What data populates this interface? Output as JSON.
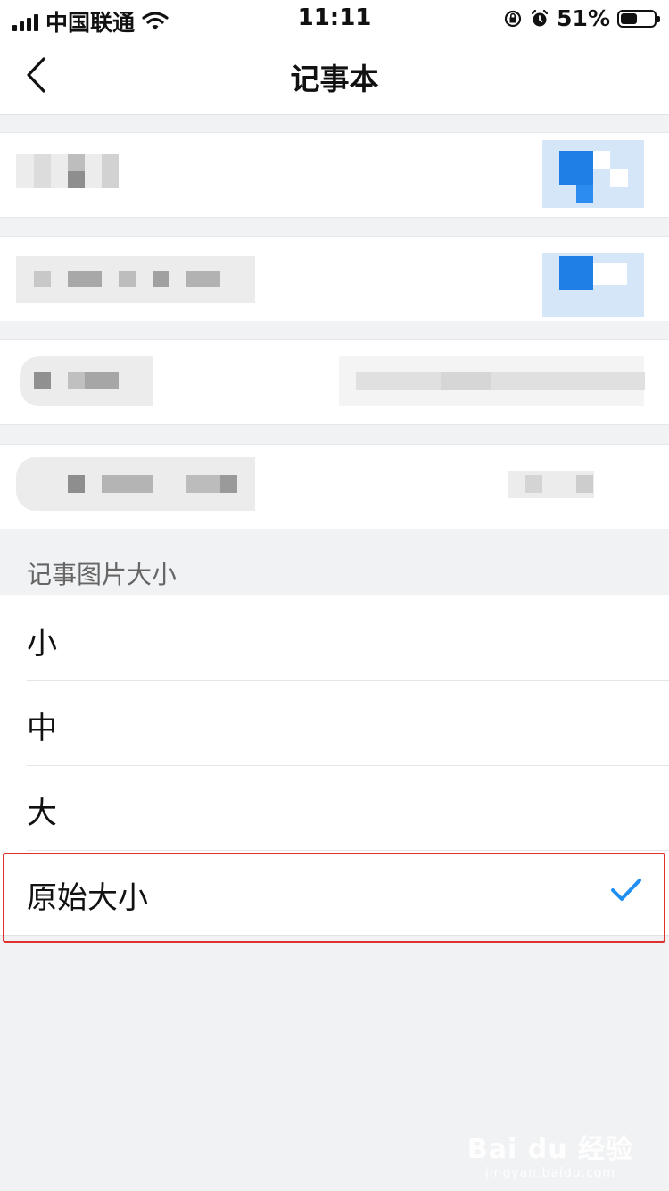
{
  "status_bar": {
    "carrier": "中国联通",
    "time": "11:11",
    "battery_percent": "51%",
    "battery_level": 0.51
  },
  "header": {
    "title": "记事本",
    "back_icon": "chevron-left-icon"
  },
  "section": {
    "title": "记事图片大小"
  },
  "options": [
    {
      "label": "小",
      "selected": false
    },
    {
      "label": "中",
      "selected": false
    },
    {
      "label": "大",
      "selected": false
    },
    {
      "label": "原始大小",
      "selected": true
    }
  ],
  "colors": {
    "accent": "#1f8ff3",
    "highlight_border": "#e0302f",
    "background": "#f1f2f4"
  },
  "watermark": {
    "main": "Bai du 经验",
    "sub": "jingyan.baidu.com"
  }
}
